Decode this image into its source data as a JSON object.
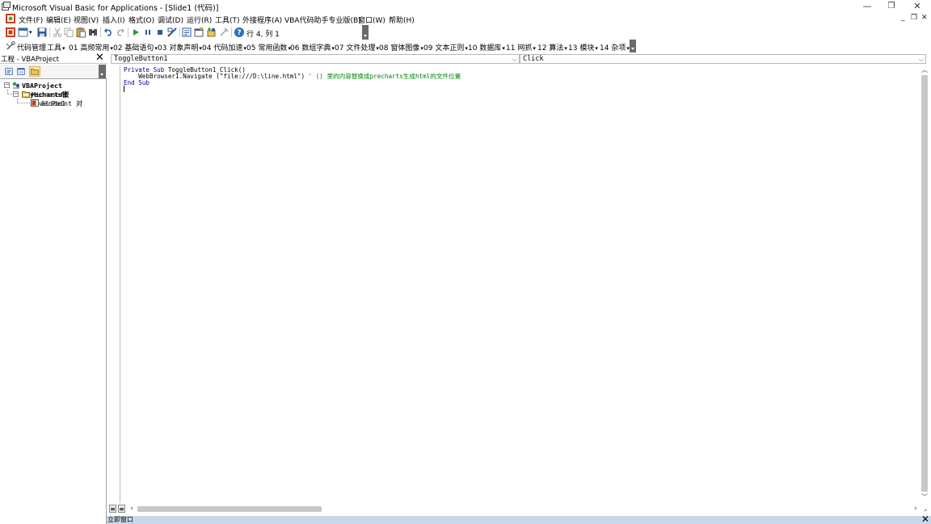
{
  "window": {
    "title": "Microsoft Visual Basic for Applications - [Slide1 (代码)]",
    "controls": {
      "minimize": "—",
      "restore": "❐",
      "close": "✕"
    }
  },
  "menubar": {
    "items": [
      "文件(F)",
      "编辑(E)",
      "视图(V)",
      "插入(I)",
      "格式(O)",
      "调试(D)",
      "运行(R)",
      "工具(T)",
      "外接程序(A)",
      "VBA代码助手专业版(B)",
      "窗口(W)",
      "帮助(H)"
    ],
    "mdi_controls": {
      "minimize": "_",
      "restore": "❐",
      "close": "✕"
    }
  },
  "toolbar1": {
    "position_text": "行 4, 列 1"
  },
  "toolbar2": {
    "items": [
      "代码管理",
      "工具",
      "01 高频常用",
      "02 基础语句",
      "03 对象声明",
      "04 代码加速",
      "05 常用函数",
      "06 数组字典",
      "07 文件处理",
      "08 窗体图像",
      "09 文本正则",
      "10 数据库",
      "11 网抓",
      "12 算法",
      "13 模块",
      "14 杂项"
    ]
  },
  "project_pane": {
    "title": "工程 - VBAProject",
    "close": "✕",
    "tree": {
      "root": "VBAProject (pyecharts嵌",
      "folder": "Microsoft PowerPoint 对",
      "slide": "Slide1"
    }
  },
  "code_window": {
    "object_combo": "ToggleButton1",
    "procedure_combo": "Click",
    "code": {
      "line1_kw1": "Private Sub",
      "line1_rest": " ToggleButton1_Click()",
      "line2_code": "    WebBrowser1.Navigate (\"file:///D:\\line.html\") ",
      "line2_comment": "' () 里的内容替换成precharts生成html的文件位置",
      "line3_kw": "End Sub"
    },
    "view_buttons": {
      "procedure": "≡",
      "full_module": "≡"
    }
  },
  "immediate_window": {
    "title": "立即窗口",
    "close": "✕"
  },
  "colors": {
    "keyword": "#00008b",
    "comment": "#008000",
    "immediate_bar": "#c9d7e6"
  }
}
